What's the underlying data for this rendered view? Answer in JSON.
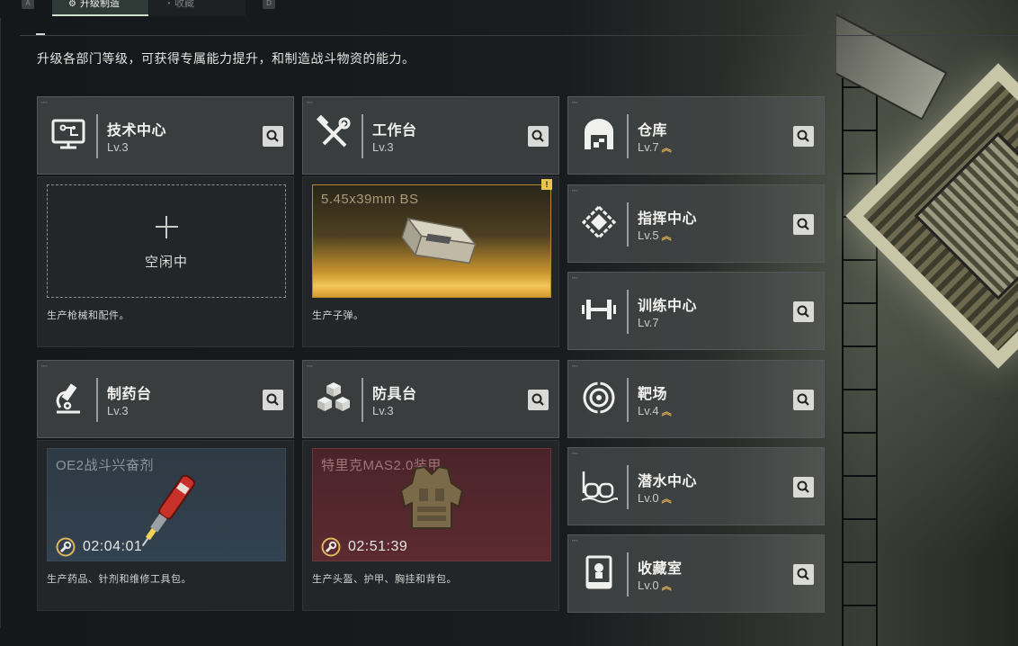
{
  "tabs": [
    {
      "label": "升级制造",
      "icon": "gear-hammer-icon",
      "active": true
    },
    {
      "label": "收藏",
      "icon": "trophy-icon",
      "active": false
    }
  ],
  "key_hints": {
    "left": "A",
    "right": "D"
  },
  "subtitle": "升级各部门等级，可获得专属能力提升，和制造战斗物资的能力。",
  "departments": {
    "tech_center": {
      "name": "技术中心",
      "level": "Lv.3",
      "icon": "computer-circuit-icon",
      "upgrade_available": false
    },
    "workbench": {
      "name": "工作台",
      "level": "Lv.3",
      "icon": "hammer-wrench-icon",
      "upgrade_available": false
    },
    "pharmacy": {
      "name": "制药台",
      "level": "Lv.3",
      "icon": "microscope-icon",
      "upgrade_available": false
    },
    "armor_bench": {
      "name": "防具台",
      "level": "Lv.3",
      "icon": "cubes-icon",
      "upgrade_available": false
    },
    "warehouse": {
      "name": "仓库",
      "level": "Lv.7",
      "icon": "warehouse-icon",
      "upgrade_available": true
    },
    "command_center": {
      "name": "指挥中心",
      "level": "Lv.5",
      "icon": "chip-diamond-icon",
      "upgrade_available": true
    },
    "training_center": {
      "name": "训练中心",
      "level": "Lv.7",
      "icon": "dumbbell-icon",
      "upgrade_available": false
    },
    "shooting_range": {
      "name": "靶场",
      "level": "Lv.4",
      "icon": "target-icon",
      "upgrade_available": true
    },
    "diving_center": {
      "name": "潜水中心",
      "level": "Lv.0",
      "icon": "diving-mask-icon",
      "upgrade_available": true
    },
    "collection_room": {
      "name": "收藏室",
      "level": "Lv.0",
      "icon": "display-case-icon",
      "upgrade_available": true
    }
  },
  "production": {
    "tech_center": {
      "state": "idle",
      "idle_label": "空闲中",
      "description": "生产枪械和配件。"
    },
    "workbench": {
      "state": "ready",
      "item": "5.45x39mm BS",
      "badge": "!",
      "description": "生产子弹。"
    },
    "pharmacy": {
      "state": "producing",
      "item": "OE2战斗兴奋剂",
      "timer": "02:04:01",
      "description": "生产药品、针剂和维修工具包。"
    },
    "armor_bench": {
      "state": "producing",
      "item": "特里克MAS2.0装甲",
      "timer": "02:51:39",
      "description": "生产头盔、护甲、胸挂和背包。"
    }
  },
  "colors": {
    "upgrade_arrow": "#e3b55a",
    "ready_gold": "#f2c659",
    "armor_red": "#5b2a30",
    "med_blue": "#334250"
  }
}
